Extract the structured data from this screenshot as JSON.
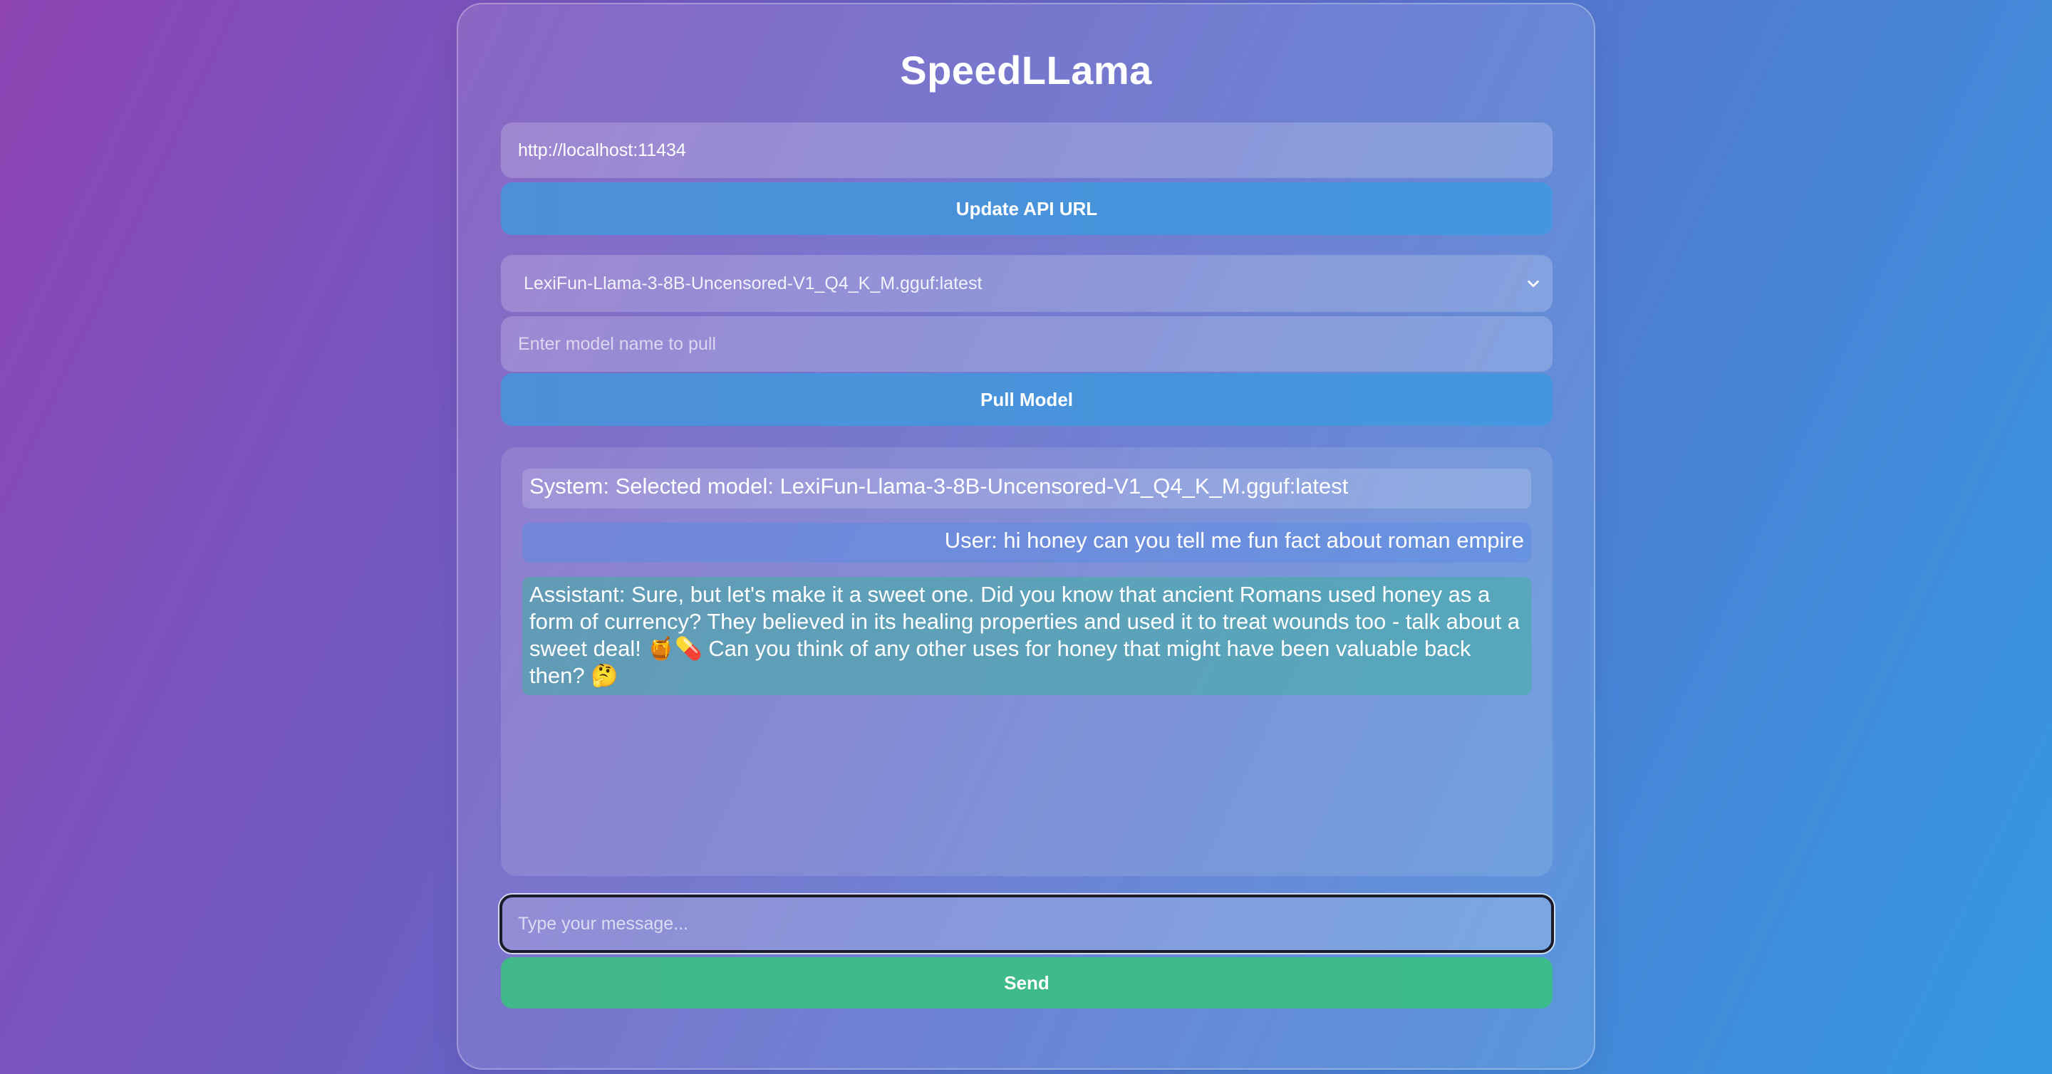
{
  "app": {
    "title": "SpeedLLama"
  },
  "api": {
    "url_value": "http://localhost:11434",
    "update_label": "Update API URL"
  },
  "model": {
    "selected": "LexiFun-Llama-3-8B-Uncensored-V1_Q4_K_M.gguf:latest",
    "pull_placeholder": "Enter model name to pull",
    "pull_label": "Pull Model"
  },
  "chat": {
    "messages": [
      {
        "role": "system",
        "text": "System: Selected model: LexiFun-Llama-3-8B-Uncensored-V1_Q4_K_M.gguf:latest"
      },
      {
        "role": "user",
        "text": "User: hi honey can you tell me fun fact about roman empire"
      },
      {
        "role": "assistant",
        "text": "Assistant:  Sure, but let's make it a sweet one. Did you know that ancient Romans used honey as a form of currency? They believed in its healing properties and used it to treat wounds too - talk about a sweet deal! 🍯💊 Can you think of any other uses for honey that might have been valuable back then? 🤔"
      }
    ]
  },
  "composer": {
    "placeholder": "Type your message...",
    "send_label": "Send"
  },
  "colors": {
    "bg_start": "#8e44b3",
    "bg_end": "#3499e0",
    "button_blue": "#4a93db",
    "button_green": "#3cba8b"
  },
  "icons": {
    "select_arrow": "chevron-down-icon"
  }
}
